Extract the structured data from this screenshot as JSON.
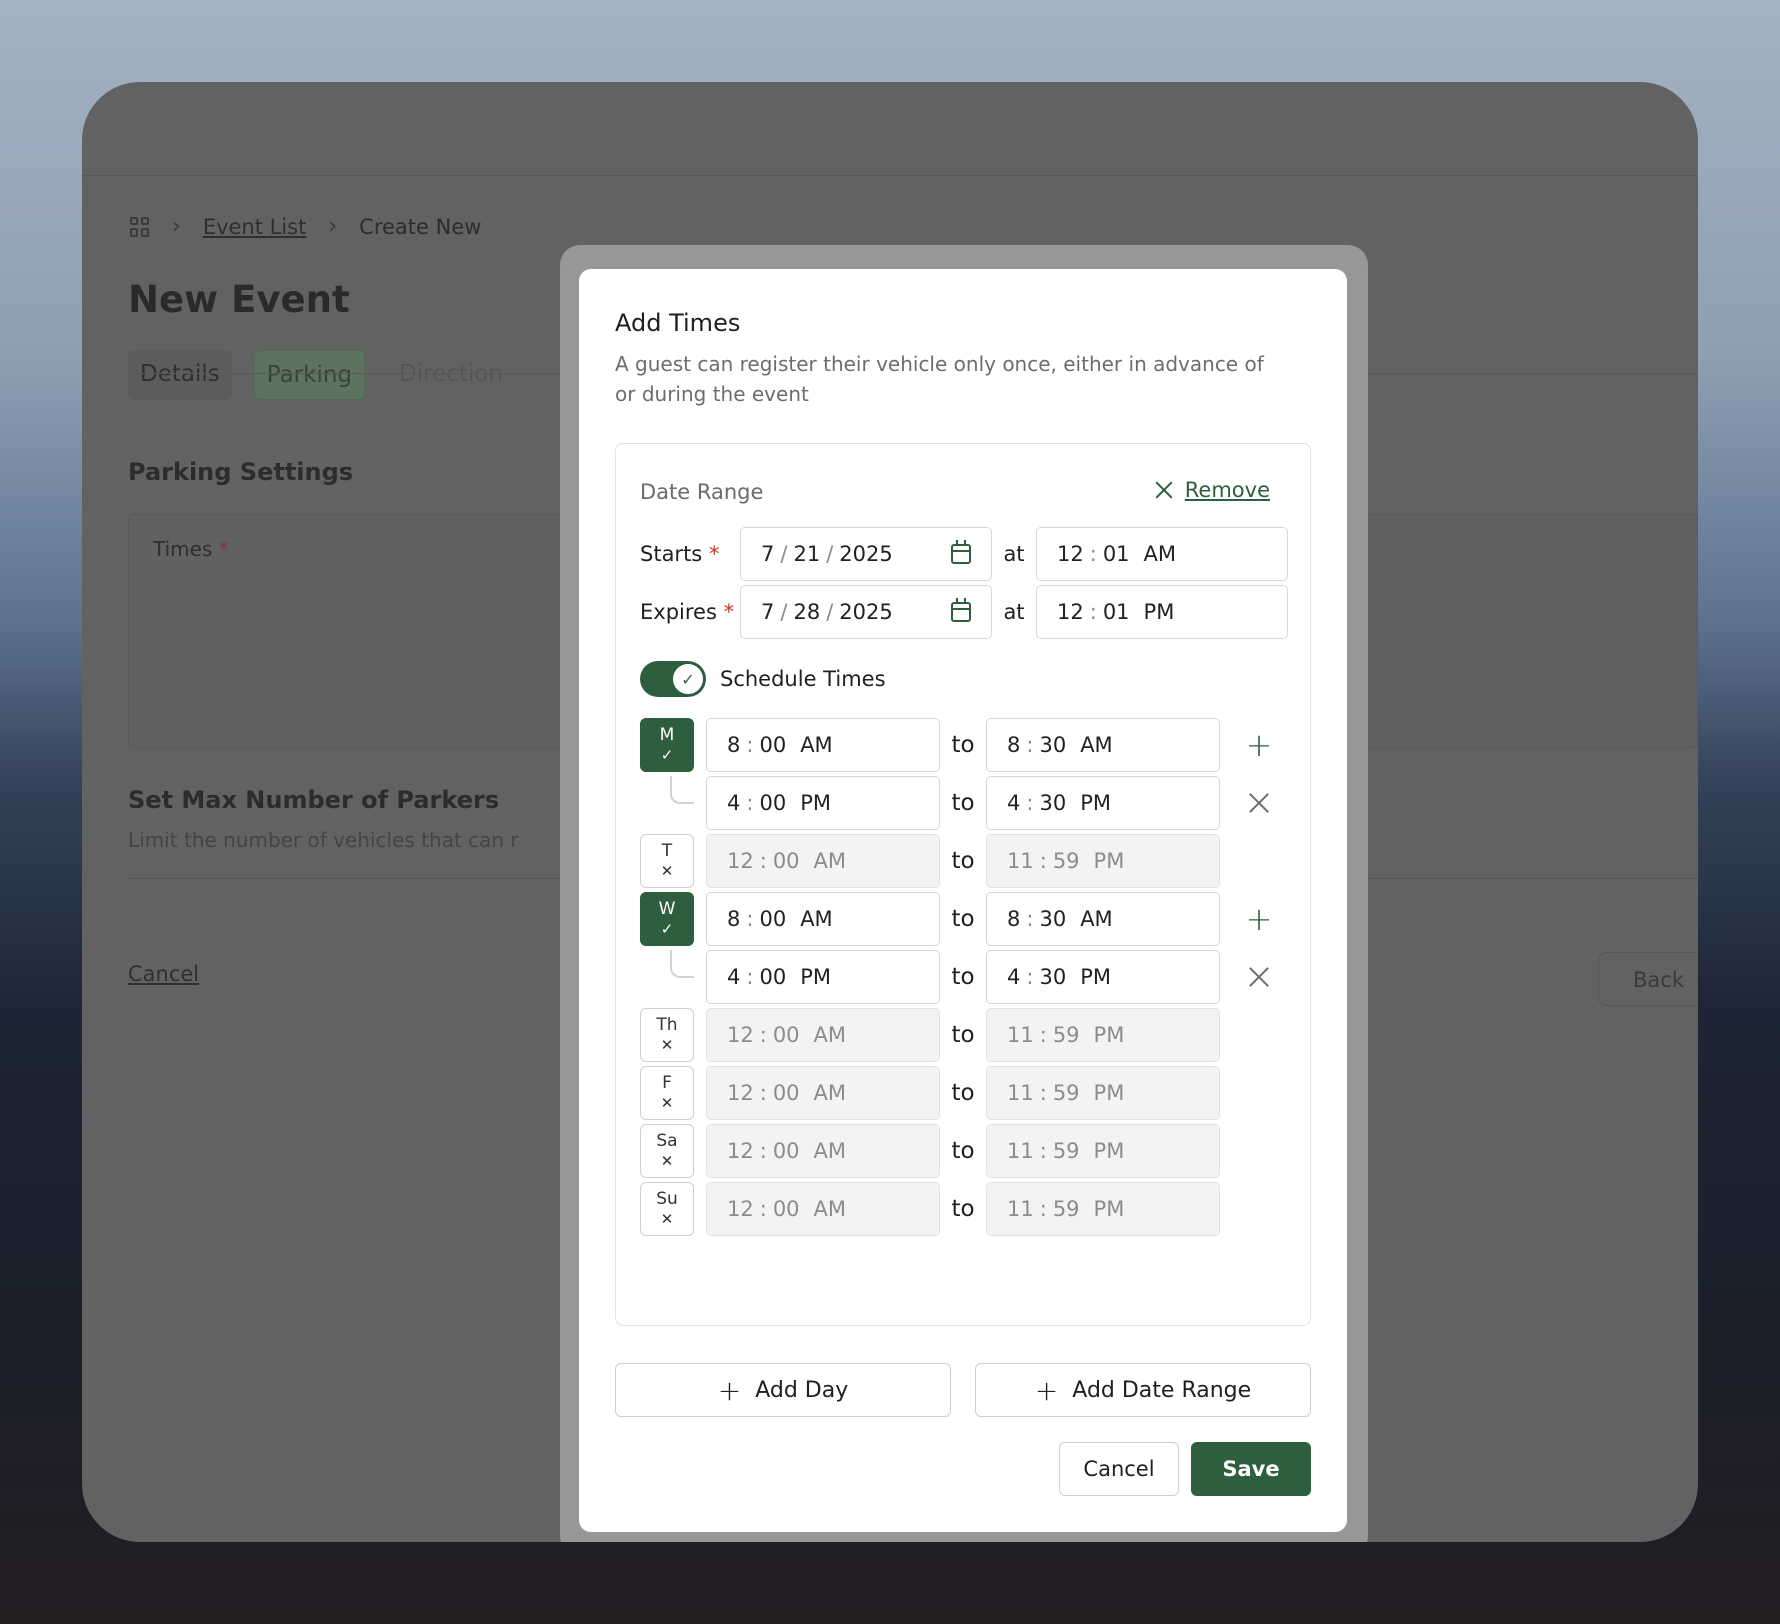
{
  "background": {
    "breadcrumb": {
      "link": "Event List",
      "current": "Create New"
    },
    "page_title": "New Event",
    "tabs": [
      "Details",
      "Parking",
      "Direction"
    ],
    "parking_settings": "Parking Settings",
    "times_label": "Times",
    "required_mark": "*",
    "max_title": "Set Max Number of Parkers",
    "max_desc": "Limit the number of vehicles that can r",
    "cancel": "Cancel",
    "back": "Back"
  },
  "modal": {
    "title": "Add Times",
    "description": "A guest can register their vehicle only once, either in advance of or during the event",
    "date_range_label": "Date Range",
    "remove_label": "Remove",
    "starts": {
      "label": "Starts",
      "req": "*",
      "month": "7",
      "day": "21",
      "year": "2025",
      "at": "at",
      "hour": "12",
      "minute": "01",
      "ampm": "AM"
    },
    "expires": {
      "label": "Expires",
      "req": "*",
      "month": "7",
      "day": "28",
      "year": "2025",
      "at": "at",
      "hour": "12",
      "minute": "01",
      "ampm": "PM"
    },
    "schedule_toggle": {
      "label": "Schedule Times",
      "checked": true
    },
    "to_label": "to",
    "days": [
      {
        "day": "M",
        "enabled": true,
        "from": {
          "h": "8",
          "m": "00",
          "p": "AM"
        },
        "to": {
          "h": "8",
          "m": "30",
          "p": "AM"
        }
      },
      {
        "day": "",
        "enabled": true,
        "from": {
          "h": "4",
          "m": "00",
          "p": "PM"
        },
        "to": {
          "h": "4",
          "m": "30",
          "p": "PM"
        }
      },
      {
        "day": "T",
        "enabled": false,
        "from": {
          "h": "12",
          "m": "00",
          "p": "AM"
        },
        "to": {
          "h": "11",
          "m": "59",
          "p": "PM"
        }
      },
      {
        "day": "W",
        "enabled": true,
        "from": {
          "h": "8",
          "m": "00",
          "p": "AM"
        },
        "to": {
          "h": "8",
          "m": "30",
          "p": "AM"
        }
      },
      {
        "day": "",
        "enabled": true,
        "from": {
          "h": "4",
          "m": "00",
          "p": "PM"
        },
        "to": {
          "h": "4",
          "m": "30",
          "p": "PM"
        }
      },
      {
        "day": "Th",
        "enabled": false,
        "from": {
          "h": "12",
          "m": "00",
          "p": "AM"
        },
        "to": {
          "h": "11",
          "m": "59",
          "p": "PM"
        }
      },
      {
        "day": "F",
        "enabled": false,
        "from": {
          "h": "12",
          "m": "00",
          "p": "AM"
        },
        "to": {
          "h": "11",
          "m": "59",
          "p": "PM"
        }
      },
      {
        "day": "Sa",
        "enabled": false,
        "from": {
          "h": "12",
          "m": "00",
          "p": "AM"
        },
        "to": {
          "h": "11",
          "m": "59",
          "p": "PM"
        }
      },
      {
        "day": "Su",
        "enabled": false,
        "from": {
          "h": "12",
          "m": "00",
          "p": "AM"
        },
        "to": {
          "h": "11",
          "m": "59",
          "p": "PM"
        }
      }
    ],
    "add_day": "Add Day",
    "add_date_range": "Add Date Range",
    "cancel": "Cancel",
    "save": "Save"
  },
  "colors": {
    "accent": "#2d5e3e",
    "overlay": "#626262"
  }
}
